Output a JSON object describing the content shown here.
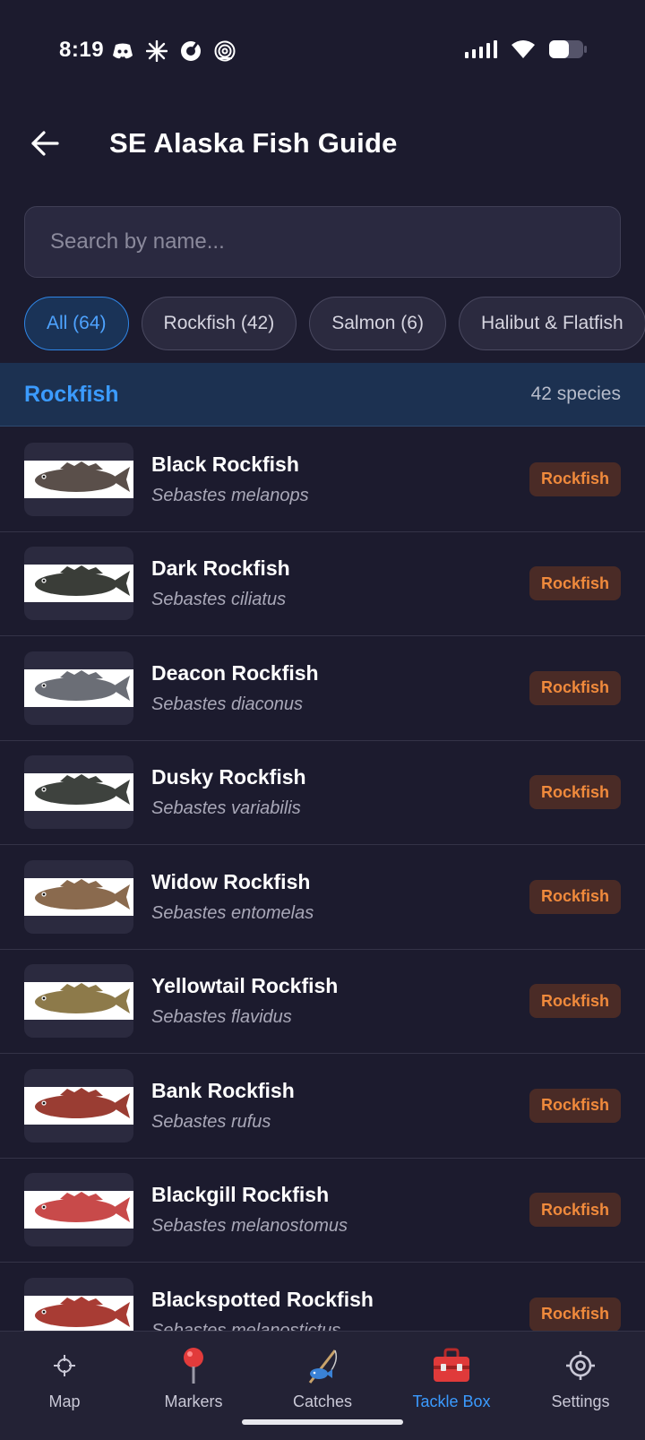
{
  "status_bar": {
    "time": "8:19",
    "left_icons": [
      "discord-icon",
      "sparkle-icon",
      "threads-icon",
      "spiral-icon"
    ],
    "right_icons": [
      "signal-icon",
      "wifi-icon",
      "battery-icon"
    ]
  },
  "header": {
    "title": "SE Alaska Fish Guide"
  },
  "search": {
    "placeholder": "Search by name...",
    "value": ""
  },
  "filters": [
    {
      "label": "All (64)",
      "active": true
    },
    {
      "label": "Rockfish (42)",
      "active": false
    },
    {
      "label": "Salmon (6)",
      "active": false
    },
    {
      "label": "Halibut & Flatfish",
      "active": false
    }
  ],
  "section": {
    "title": "Rockfish",
    "count": "42 species"
  },
  "fish": [
    {
      "name": "Black Rockfish",
      "scientific": "Sebastes melanops",
      "tag": "Rockfish",
      "color": "#5a4f4a"
    },
    {
      "name": "Dark Rockfish",
      "scientific": "Sebastes ciliatus",
      "tag": "Rockfish",
      "color": "#3a3d38"
    },
    {
      "name": "Deacon Rockfish",
      "scientific": "Sebastes diaconus",
      "tag": "Rockfish",
      "color": "#6b6e76"
    },
    {
      "name": "Dusky Rockfish",
      "scientific": "Sebastes variabilis",
      "tag": "Rockfish",
      "color": "#3e423e"
    },
    {
      "name": "Widow Rockfish",
      "scientific": "Sebastes entomelas",
      "tag": "Rockfish",
      "color": "#8a6a4e"
    },
    {
      "name": "Yellowtail Rockfish",
      "scientific": "Sebastes flavidus",
      "tag": "Rockfish",
      "color": "#8d7a4a"
    },
    {
      "name": "Bank Rockfish",
      "scientific": "Sebastes rufus",
      "tag": "Rockfish",
      "color": "#9a3d33"
    },
    {
      "name": "Blackgill Rockfish",
      "scientific": "Sebastes melanostomus",
      "tag": "Rockfish",
      "color": "#c84a4a"
    },
    {
      "name": "Blackspotted Rockfish",
      "scientific": "Sebastes melanostictus",
      "tag": "Rockfish",
      "color": "#a83c34"
    }
  ],
  "bottom_nav": [
    {
      "label": "Map",
      "icon": "crosshair-icon",
      "active": false
    },
    {
      "label": "Markers",
      "icon": "map-pin-icon",
      "active": false
    },
    {
      "label": "Catches",
      "icon": "fishing-rod-icon",
      "active": false
    },
    {
      "label": "Tackle Box",
      "icon": "toolbox-icon",
      "active": true
    },
    {
      "label": "Settings",
      "icon": "gear-icon",
      "active": false
    }
  ]
}
